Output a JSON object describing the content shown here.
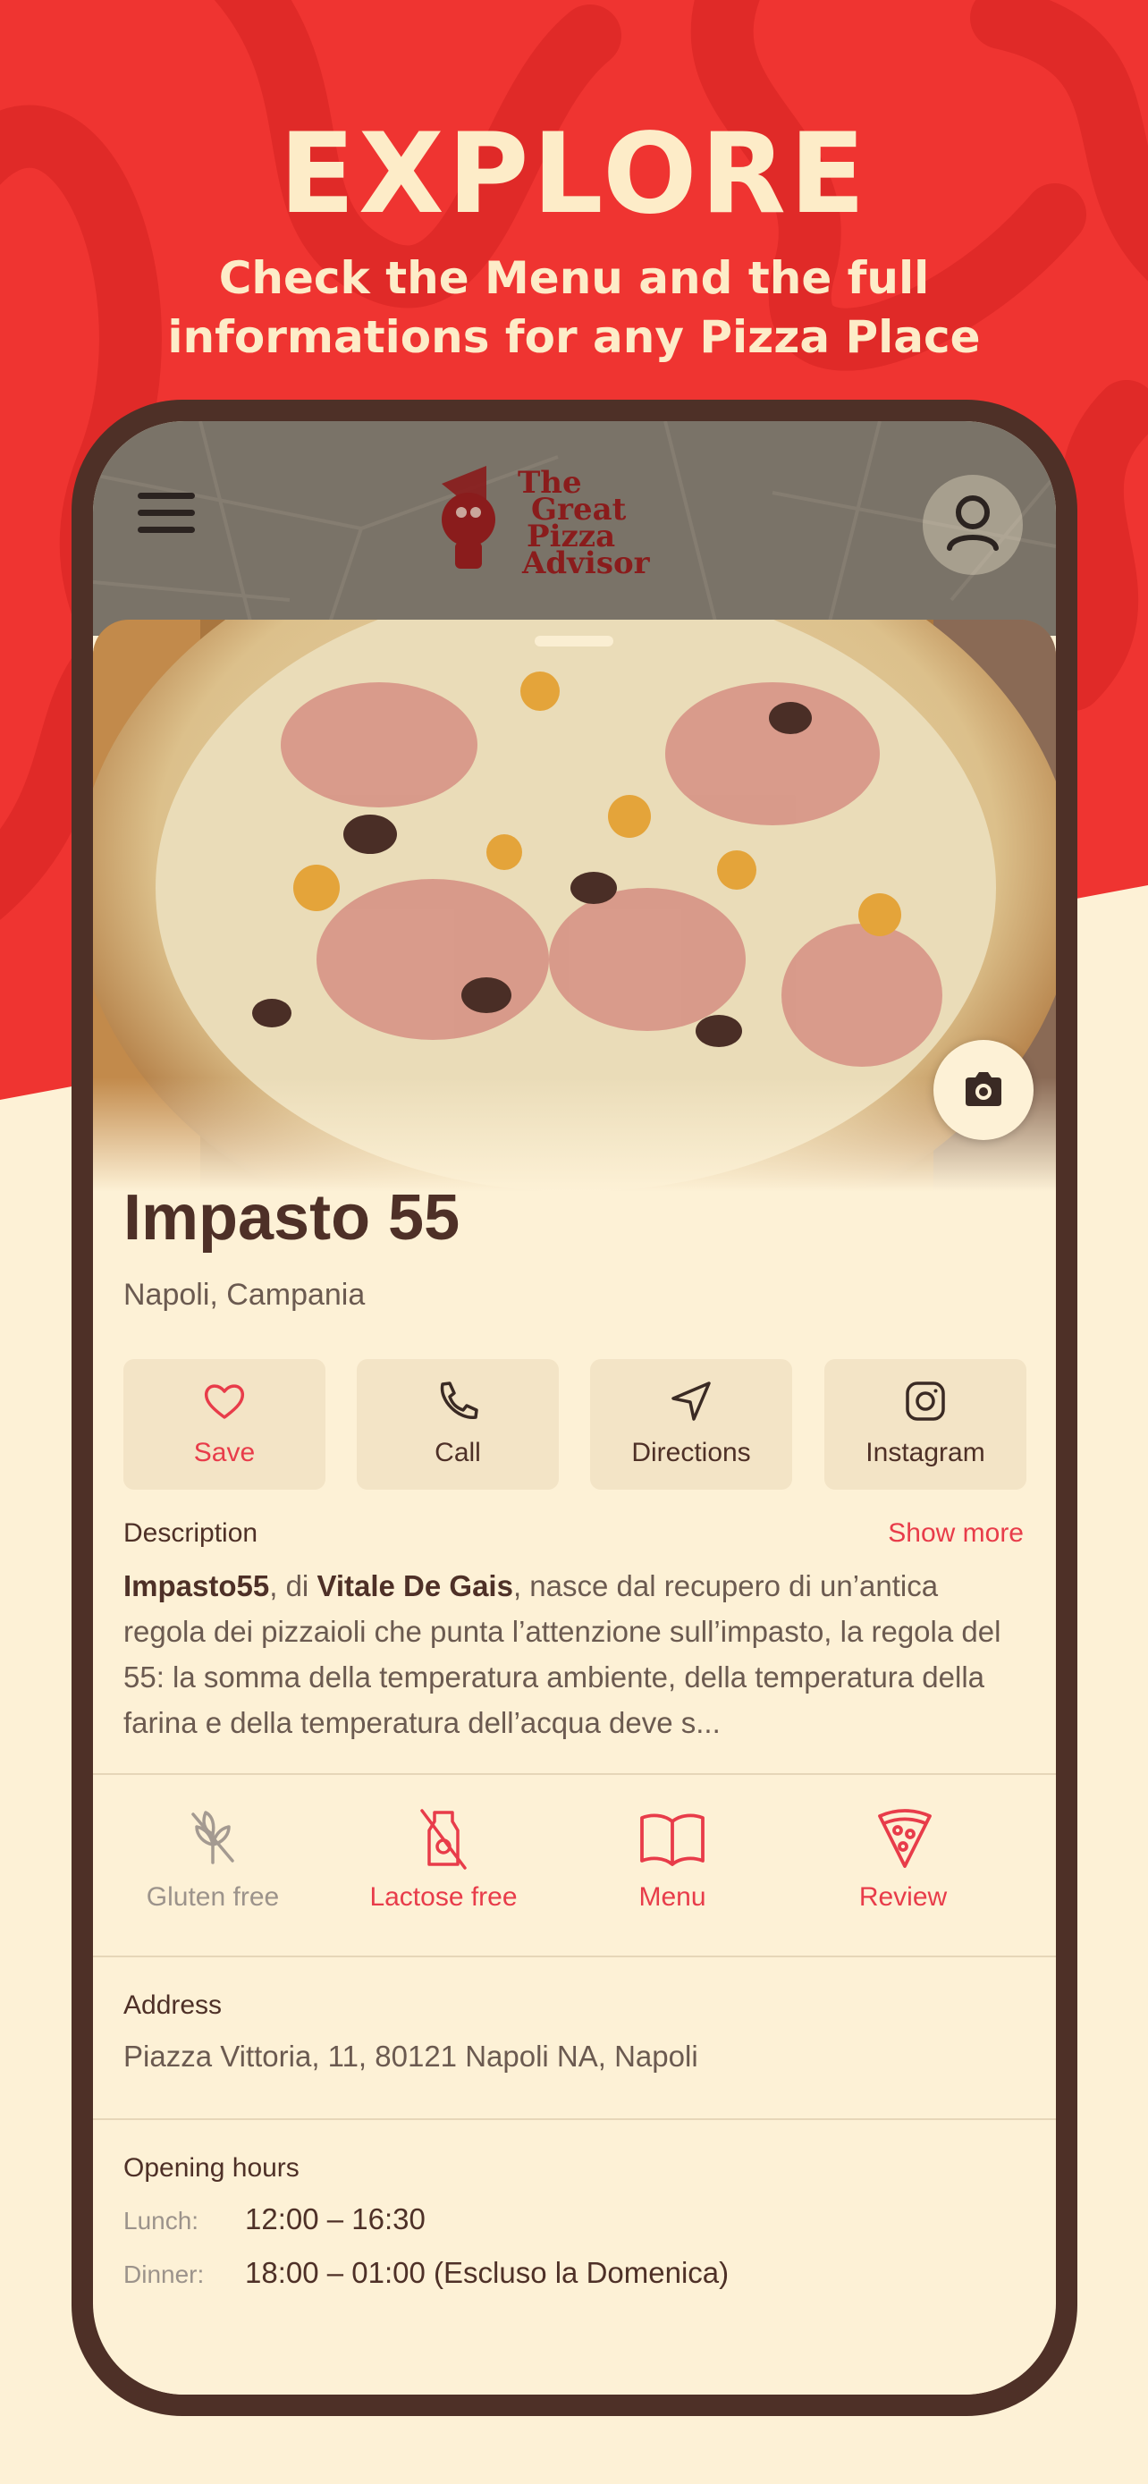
{
  "hero": {
    "title": "EXPLORE",
    "subtitle": "Check the Menu and the full\ninformations for any Pizza Place"
  },
  "app": {
    "logo_lines": [
      "The",
      "Great",
      "Pizza",
      "Advisor"
    ],
    "menu_icon": "hamburger-menu-icon",
    "profile_icon": "user-icon",
    "camera_icon": "camera-icon"
  },
  "place": {
    "name": "Impasto 55",
    "city": "Napoli, Campania"
  },
  "actions": [
    {
      "label": "Save",
      "icon": "heart-icon"
    },
    {
      "label": "Call",
      "icon": "phone-icon"
    },
    {
      "label": "Directions",
      "icon": "navigation-arrow-icon"
    },
    {
      "label": "Instagram",
      "icon": "instagram-icon"
    }
  ],
  "description": {
    "heading": "Description",
    "show_more": "Show more",
    "name_bold": "Impasto55",
    "sep1": ", di ",
    "person_bold": "Vitale De Gais",
    "text": ", nasce dal recupero di un’antica regola dei pizzaioli che punta l’attenzione sull’impasto, la regola del 55: la somma della temperatura ambiente, della temperatura della farina e della temperatura dell’acqua deve s..."
  },
  "features": [
    {
      "label": "Gluten free",
      "icon": "gluten-free-icon",
      "active": false
    },
    {
      "label": "Lactose free",
      "icon": "lactose-free-icon",
      "active": true
    },
    {
      "label": "Menu",
      "icon": "book-open-icon",
      "active": true
    },
    {
      "label": "Review",
      "icon": "pizza-slice-icon",
      "active": true
    }
  ],
  "address": {
    "label": "Address",
    "value": "Piazza Vittoria, 11, 80121 Napoli NA, Napoli"
  },
  "hours": {
    "label": "Opening hours",
    "rows": [
      {
        "key": "Lunch:",
        "value": "12:00 – 16:30"
      },
      {
        "key": "Dinner:",
        "value": "18:00 – 01:00 (Escluso la Domenica)"
      }
    ]
  },
  "colors": {
    "brand_red": "#ef3431",
    "cream": "#fdf1d6",
    "frame_brown": "#4e3027",
    "accent_red": "#e83c4a"
  }
}
